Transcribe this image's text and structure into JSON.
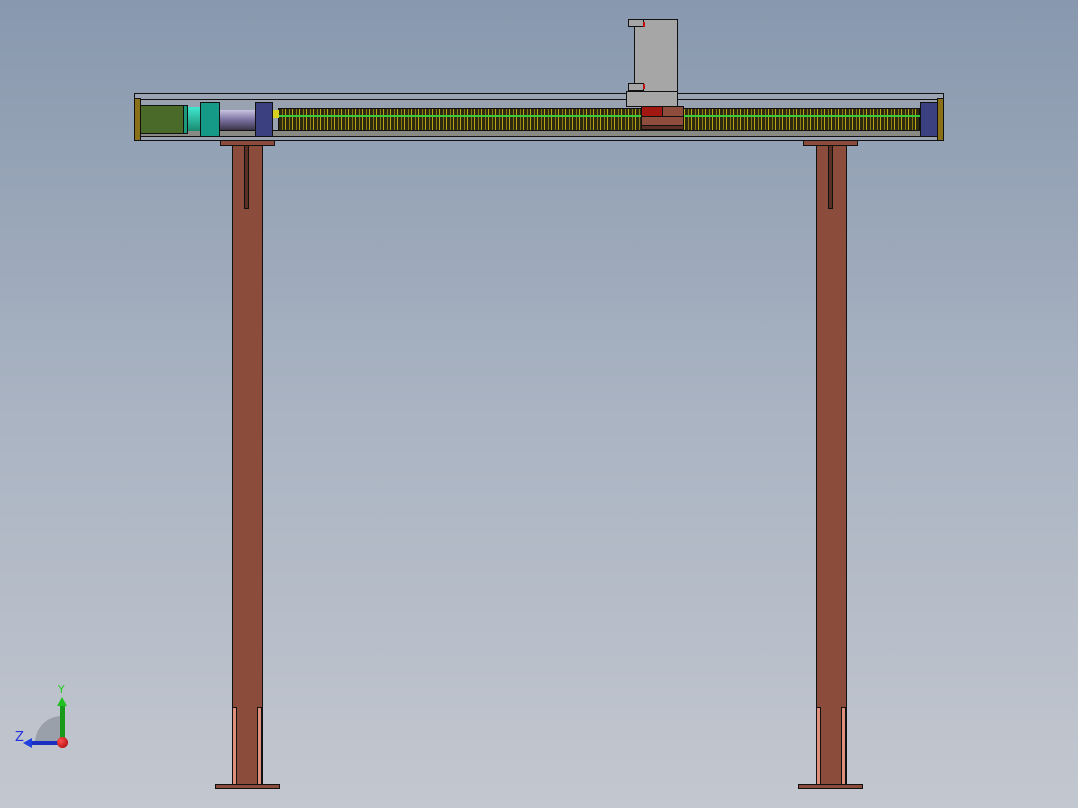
{
  "viewport": {
    "type": "cad-front-view"
  },
  "triad": {
    "y_label": "Y",
    "z_label": "Z"
  },
  "colors": {
    "leg": "#8b4c3c",
    "motor": "#4a6a2a",
    "coupling": "#1a9a8a",
    "bearing": "#3a4080",
    "end_cap": "#8a7018",
    "carriage": "#a6a6a6",
    "slider_red": "#a01810"
  }
}
